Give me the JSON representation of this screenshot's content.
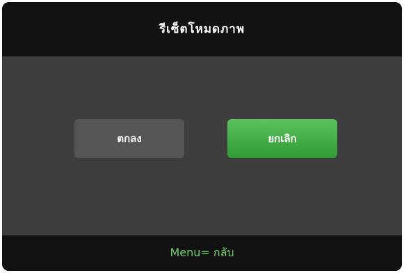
{
  "dialog": {
    "title": "รีเซ็ตโหมดภาพ",
    "ok_label": "ตกลง",
    "cancel_label": "ยกเลิก",
    "footer_hint": "Menu= กลับ"
  },
  "colors": {
    "frame": "#111111",
    "body": "#3e3e3e",
    "ok_button": "#555555",
    "cancel_button": "#3aa83e",
    "footer_text": "#6fd36b",
    "title_text": "#ffffff"
  }
}
